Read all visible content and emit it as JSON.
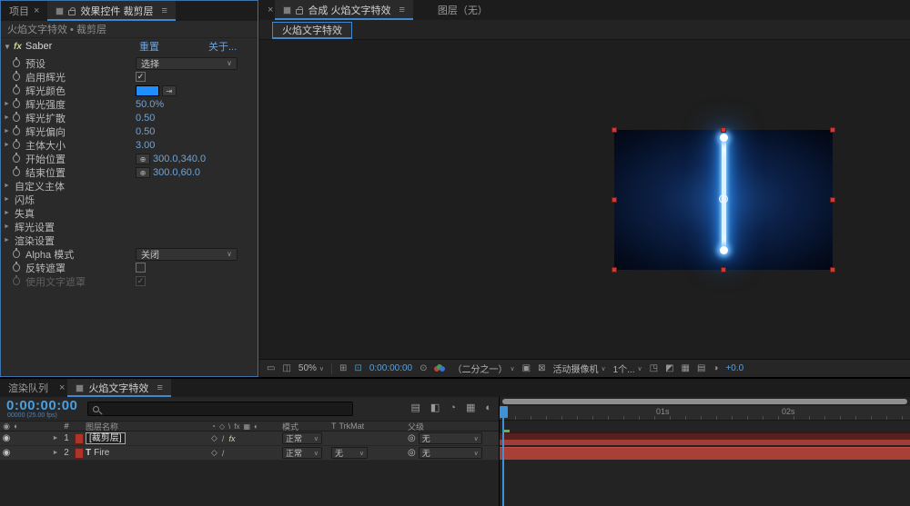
{
  "icons": {
    "close": "×",
    "menu": "≡",
    "chevron": "∨",
    "tri_right": "►",
    "tri_down": "▼",
    "check": "✓",
    "crosshair": "⊕",
    "eye": "◉",
    "audio": "◖",
    "monitor": "▭",
    "monitor2": "◫",
    "grid": "⊞",
    "region": "⊡",
    "snapshot": "⊙",
    "roi": "▣",
    "transparency": "⊠",
    "share_view": "◳",
    "grid_guides": "▤",
    "rulers": "▦",
    "pixel_aspect": "◩",
    "exposure": "◑",
    "mini_flowchart": "▤",
    "draft_3d": "◧",
    "shy": "◔",
    "frame_blend": "▦",
    "motion_blur": "◐",
    "collapse": "◇",
    "quality": "/",
    "quality_header": "\\",
    "fx_badge": "fx",
    "pickwhip": "◎",
    "eyedropper": "⇥",
    "hash": "#"
  },
  "effect_controls": {
    "tab_project": "项目",
    "tab_title": "效果控件 裁剪层",
    "breadcrumb": "火焰文字特效 • 裁剪层",
    "effect_name": "Saber",
    "reset_label": "重置",
    "about_label": "关于...",
    "props": {
      "preset": {
        "label": "预设",
        "value": "选择"
      },
      "enable_glow": {
        "label": "启用辉光"
      },
      "glow_color": {
        "label": "辉光颜色",
        "style": "background:#1f8fff"
      },
      "glow_intensity": {
        "label": "辉光强度",
        "value": "50.0%"
      },
      "glow_spread": {
        "label": "辉光扩散",
        "value": "0.50"
      },
      "glow_bias": {
        "label": "辉光偏向",
        "value": "0.50"
      },
      "core_size": {
        "label": "主体大小",
        "value": "3.00"
      },
      "start_position": {
        "label": "开始位置",
        "value": "300.0,340.0"
      },
      "end_position": {
        "label": "结束位置",
        "value": "300.0,60.0"
      },
      "customize_core": {
        "label": "自定义主体"
      },
      "flicker": {
        "label": "闪烁"
      },
      "distortion": {
        "label": "失真"
      },
      "glow_settings": {
        "label": "辉光设置"
      },
      "render_settings": {
        "label": "渲染设置"
      },
      "alpha_mode": {
        "label": "Alpha 模式",
        "value": "关闭"
      },
      "invert_mask": {
        "label": "反转遮罩"
      },
      "use_text_mask": {
        "label": "使用文字遮罩"
      }
    }
  },
  "comp_panel": {
    "tab_title": "合成 火焰文字特效",
    "tab_layer": "图层（无）",
    "viewer_tab": "火焰文字特效",
    "toolbar": {
      "zoom": "50%",
      "timecode": "0:00:00:00",
      "resolution": "（二分之一）",
      "camera": "活动摄像机",
      "views": "1个...",
      "exposure": "+0.0"
    }
  },
  "timeline": {
    "tab_render_queue": "渲染队列",
    "tab_comp": "火焰文字特效",
    "timecode": "0:00:00:00",
    "frame_info": "00000 (25.00 fps)",
    "headers": {
      "index": "#",
      "layer_name": "图层名称",
      "mode": "模式",
      "t": "T",
      "trkmat": "TrkMat",
      "parent": "父级"
    },
    "layers": [
      {
        "index": "1",
        "name": "[裁剪层]",
        "mode": "正常",
        "parent": "无"
      },
      {
        "index": "2",
        "type_badge": "T",
        "name": "Fire",
        "mode": "正常",
        "trkmat": "无",
        "parent": "无"
      }
    ],
    "ruler_labels": [
      "01s",
      "02s"
    ]
  }
}
